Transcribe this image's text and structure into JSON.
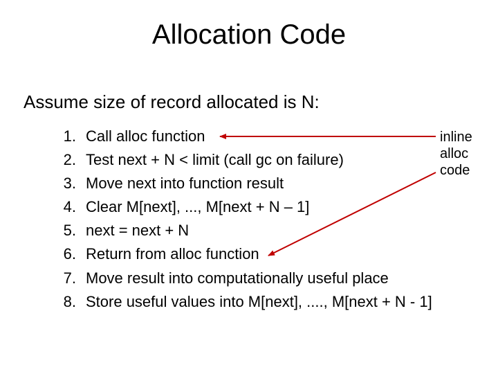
{
  "title": "Allocation Code",
  "subtitle": "Assume size of record allocated is N:",
  "steps": [
    {
      "n": "1.",
      "text": "Call alloc function"
    },
    {
      "n": "2.",
      "text": "Test next + N < limit   (call gc on failure)"
    },
    {
      "n": "3.",
      "text": "Move next into function result"
    },
    {
      "n": "4.",
      "text": "Clear M[next], ..., M[next + N – 1]"
    },
    {
      "n": "5.",
      "text": "next = next + N"
    },
    {
      "n": "6.",
      "text": "Return from alloc function"
    },
    {
      "n": "7.",
      "text": "Move result into computationally useful place"
    },
    {
      "n": "8.",
      "text": "Store useful values into M[next], ...., M[next + N - 1]"
    }
  ],
  "annotation": {
    "line1": "inline",
    "line2": "alloc",
    "line3": "code"
  },
  "colors": {
    "arrow": "#c00000"
  }
}
